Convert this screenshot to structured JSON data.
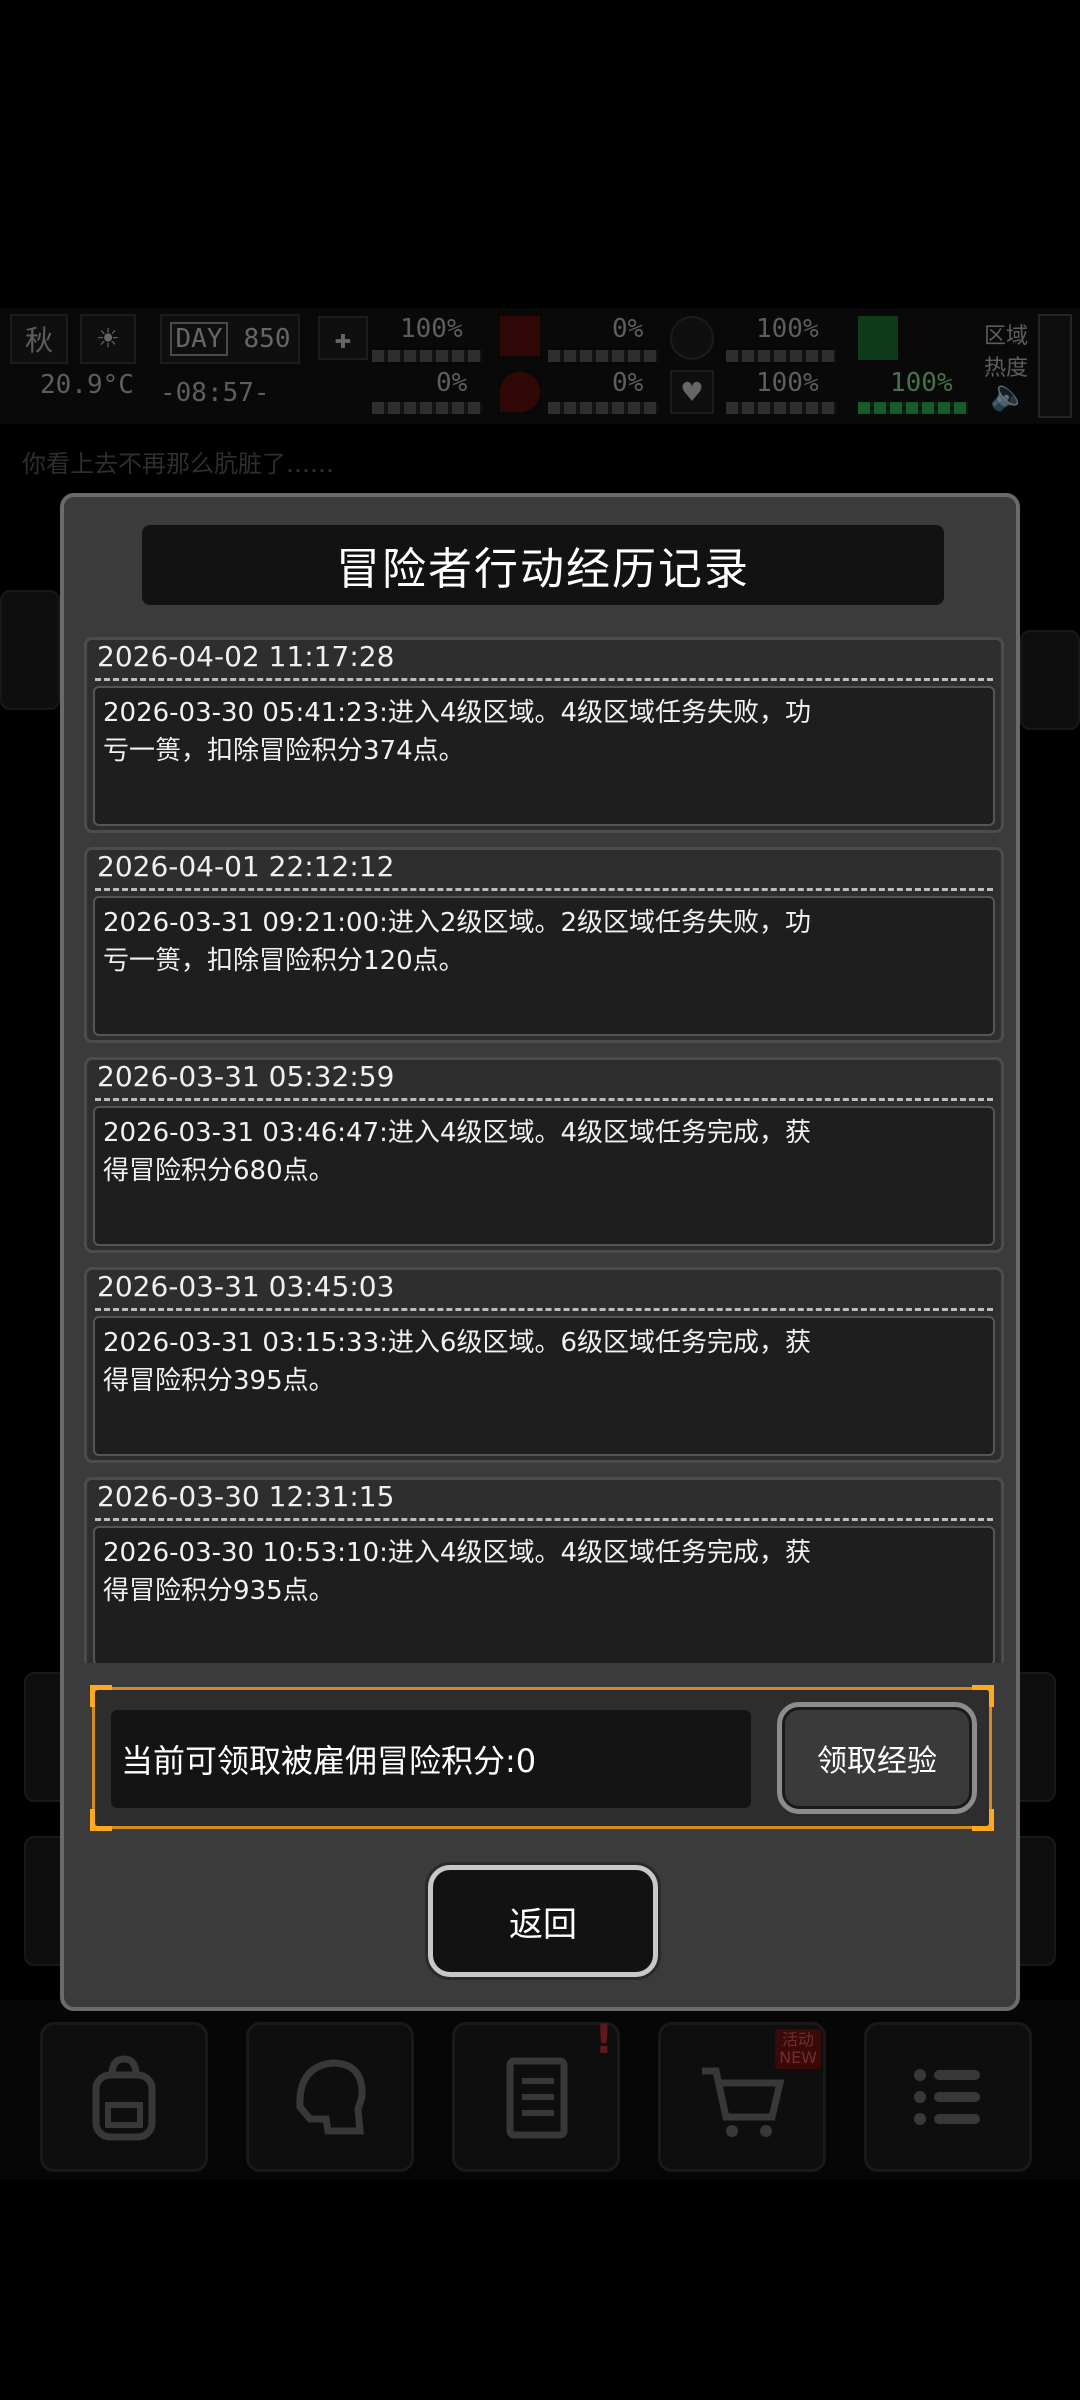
{
  "hud": {
    "season": "秋",
    "temperature": "20.9°C",
    "day_label": "DAY",
    "day_number": "850",
    "clock": "-08:57-",
    "health_pct": "100%",
    "stat2_pct": "0%",
    "stat3_pct": "100%",
    "stat4_pct": "0%",
    "stat5_pct": "0%",
    "stat6_pct": "100%",
    "stat7_pct": "100%",
    "area_heat_label": "区域\n热度"
  },
  "background": {
    "log_lines": [
      "你看上去不再那么肮脏了……"
    ]
  },
  "dialog": {
    "title": "冒险者行动经历记录",
    "records": [
      {
        "timestamp": "2026-04-02 11:17:28",
        "text": "2026-03-30 05:41:23:进入4级区域。4级区域任务失败，功\n亏一篑，扣除冒险积分374点。"
      },
      {
        "timestamp": "2026-04-01 22:12:12",
        "text": "2026-03-31 09:21:00:进入2级区域。2级区域任务失败，功\n亏一篑，扣除冒险积分120点。"
      },
      {
        "timestamp": "2026-03-31 05:32:59",
        "text": "2026-03-31 03:46:47:进入4级区域。4级区域任务完成，获\n得冒险积分680点。"
      },
      {
        "timestamp": "2026-03-31 03:45:03",
        "text": "2026-03-31 03:15:33:进入6级区域。6级区域任务完成，获\n得冒险积分395点。"
      },
      {
        "timestamp": "2026-03-30 12:31:15",
        "text": "2026-03-30 10:53:10:进入4级区域。4级区域任务完成，获\n得冒险积分935点。"
      }
    ],
    "claim_text": "当前可领取被雇佣冒险积分:0",
    "claim_button": "领取经验",
    "back_button": "返回"
  },
  "bottom_nav": {
    "shop_badge": "活动\nNEW",
    "items": [
      "backpack-icon",
      "brain-icon",
      "notebook-icon",
      "shopping-cart-icon",
      "menu-list-icon"
    ]
  }
}
